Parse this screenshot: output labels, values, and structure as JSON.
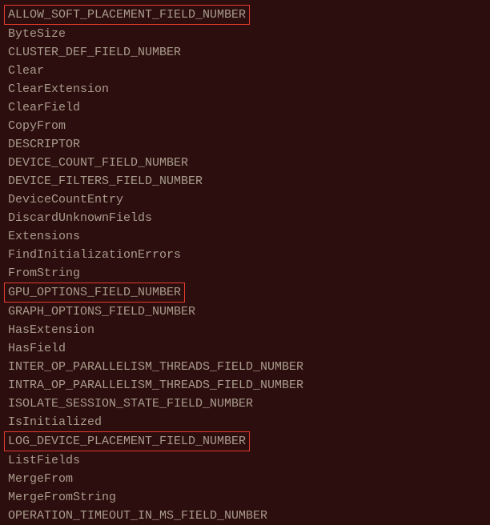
{
  "lines": [
    {
      "text": "ALLOW_SOFT_PLACEMENT_FIELD_NUMBER",
      "highlighted": true
    },
    {
      "text": "ByteSize",
      "highlighted": false
    },
    {
      "text": "CLUSTER_DEF_FIELD_NUMBER",
      "highlighted": false
    },
    {
      "text": "Clear",
      "highlighted": false
    },
    {
      "text": "ClearExtension",
      "highlighted": false
    },
    {
      "text": "ClearField",
      "highlighted": false
    },
    {
      "text": "CopyFrom",
      "highlighted": false
    },
    {
      "text": "DESCRIPTOR",
      "highlighted": false
    },
    {
      "text": "DEVICE_COUNT_FIELD_NUMBER",
      "highlighted": false
    },
    {
      "text": "DEVICE_FILTERS_FIELD_NUMBER",
      "highlighted": false
    },
    {
      "text": "DeviceCountEntry",
      "highlighted": false
    },
    {
      "text": "DiscardUnknownFields",
      "highlighted": false
    },
    {
      "text": "Extensions",
      "highlighted": false
    },
    {
      "text": "FindInitializationErrors",
      "highlighted": false
    },
    {
      "text": "FromString",
      "highlighted": false
    },
    {
      "text": "GPU_OPTIONS_FIELD_NUMBER",
      "highlighted": true
    },
    {
      "text": "GRAPH_OPTIONS_FIELD_NUMBER",
      "highlighted": false
    },
    {
      "text": "HasExtension",
      "highlighted": false
    },
    {
      "text": "HasField",
      "highlighted": false
    },
    {
      "text": "INTER_OP_PARALLELISM_THREADS_FIELD_NUMBER",
      "highlighted": false
    },
    {
      "text": "INTRA_OP_PARALLELISM_THREADS_FIELD_NUMBER",
      "highlighted": false
    },
    {
      "text": "ISOLATE_SESSION_STATE_FIELD_NUMBER",
      "highlighted": false
    },
    {
      "text": "IsInitialized",
      "highlighted": false
    },
    {
      "text": "LOG_DEVICE_PLACEMENT_FIELD_NUMBER",
      "highlighted": true
    },
    {
      "text": "ListFields",
      "highlighted": false
    },
    {
      "text": "MergeFrom",
      "highlighted": false
    },
    {
      "text": "MergeFromString",
      "highlighted": false
    },
    {
      "text": "OPERATION_TIMEOUT_IN_MS_FIELD_NUMBER",
      "highlighted": false
    }
  ]
}
